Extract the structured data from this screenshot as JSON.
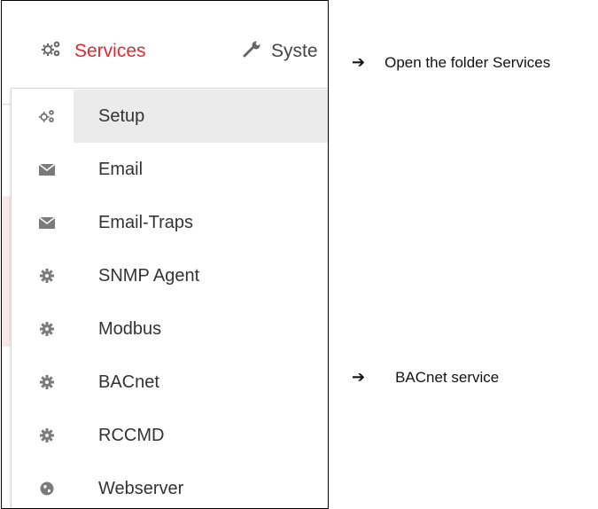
{
  "nav": {
    "services_label": "Services",
    "system_label": "Syste",
    "services_icon": "gears-icon",
    "system_icon": "wrench-icon",
    "accent_color": "#e8262f"
  },
  "menu": {
    "items": [
      {
        "label": "Setup",
        "icon": "gears-icon"
      },
      {
        "label": "Email",
        "icon": "envelope-icon"
      },
      {
        "label": "Email-Traps",
        "icon": "envelope-icon"
      },
      {
        "label": "SNMP Agent",
        "icon": "gear-icon"
      },
      {
        "label": "Modbus",
        "icon": "gear-icon"
      },
      {
        "label": "BACnet",
        "icon": "gear-icon"
      },
      {
        "label": "RCCMD",
        "icon": "gear-icon"
      },
      {
        "label": "Webserver",
        "icon": "globe-icon"
      }
    ]
  },
  "annotations": {
    "arrow": "➔",
    "open_services": "Open the folder Services",
    "bacnet_service": "BACnet service"
  }
}
